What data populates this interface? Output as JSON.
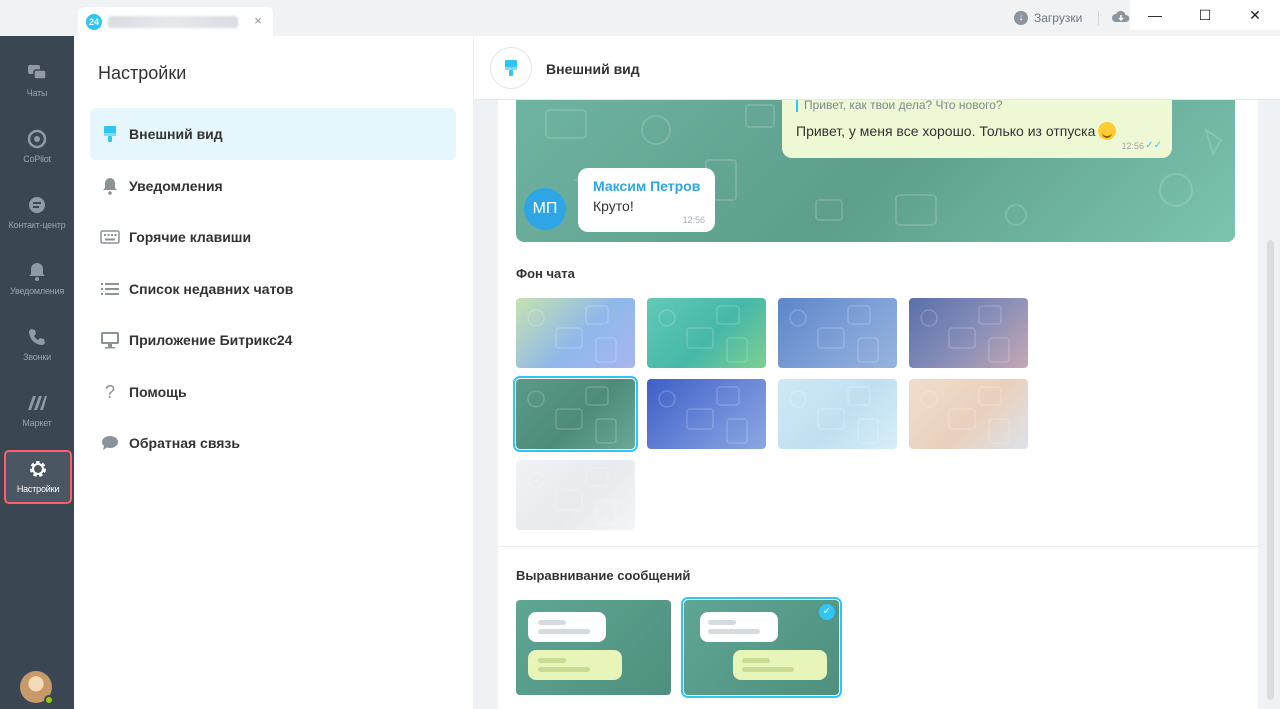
{
  "window": {
    "tab_badge": "24",
    "tab_close": "×",
    "downloads_label": "Загрузки",
    "minimize": "—",
    "maximize": "☐",
    "close": "✕"
  },
  "leftnav": {
    "items": [
      {
        "label": "Чаты",
        "icon": "chats-icon"
      },
      {
        "label": "CoPilot",
        "icon": "copilot-icon"
      },
      {
        "label": "Контакт-центр",
        "icon": "contact-center-icon"
      },
      {
        "label": "Уведомления",
        "icon": "bell-icon"
      },
      {
        "label": "Звонки",
        "icon": "phone-icon"
      },
      {
        "label": "Маркет",
        "icon": "market-icon"
      },
      {
        "label": "Настройки",
        "icon": "gear-icon"
      }
    ],
    "active_index": 6,
    "active_outline_color": "#ff5c6c"
  },
  "menu": {
    "title": "Настройки",
    "items": [
      {
        "label": "Внешний вид",
        "icon": "brush-icon"
      },
      {
        "label": "Уведомления",
        "icon": "bell-icon"
      },
      {
        "label": "Горячие клавиши",
        "icon": "keyboard-icon"
      },
      {
        "label": "Список недавних чатов",
        "icon": "list-icon"
      },
      {
        "label": "Приложение Битрикс24",
        "icon": "monitor-icon"
      },
      {
        "label": "Помощь",
        "icon": "help-icon"
      },
      {
        "label": "Обратная связь",
        "icon": "feedback-icon"
      }
    ],
    "active_index": 0
  },
  "content": {
    "header_title": "Внешний вид",
    "preview": {
      "quote": "Привет, как твои дела? Что нового?",
      "outgoing_text": "Привет, у меня все хорошо. Только из отпуска",
      "outgoing_time": "12:56",
      "sender_initials": "МП",
      "sender_name": "Максим Петров",
      "incoming_text": "Круто!",
      "incoming_time": "12:56"
    },
    "background_section_title": "Фон чата",
    "backgrounds": [
      {
        "name": "bg-1",
        "colors": [
          "#c6e3b0",
          "#8fb8ea",
          "#a9b6f0"
        ]
      },
      {
        "name": "bg-2",
        "colors": [
          "#62c9b6",
          "#46b8a8",
          "#7fcf8f"
        ]
      },
      {
        "name": "bg-3",
        "colors": [
          "#5b86c8",
          "#7fa0d8",
          "#98b4dc"
        ]
      },
      {
        "name": "bg-4",
        "colors": [
          "#5a6fab",
          "#8a8fb8",
          "#c7a8b3"
        ]
      },
      {
        "name": "bg-5",
        "colors": [
          "#5b9a86",
          "#4e8c7a",
          "#6aa994"
        ]
      },
      {
        "name": "bg-6",
        "colors": [
          "#3d5fc7",
          "#6b88d8",
          "#8aa8e0"
        ]
      },
      {
        "name": "bg-7",
        "colors": [
          "#cfe9f5",
          "#bfe0f2",
          "#d7eef8"
        ]
      },
      {
        "name": "bg-8",
        "colors": [
          "#f1ddcc",
          "#ead0bd",
          "#dde3ea"
        ]
      },
      {
        "name": "bg-9",
        "colors": [
          "#f0f2f4",
          "#e8ebee",
          "#f3f5f6"
        ]
      }
    ],
    "background_selected_index": 4,
    "alignment_section_title": "Выравнивание сообщений",
    "alignment_options": [
      {
        "name": "align-left"
      },
      {
        "name": "align-sides"
      }
    ],
    "alignment_selected_index": 1,
    "check_mark": "✓"
  },
  "colors": {
    "accent": "#2fc6f6",
    "nav_bg": "#3b4653",
    "active_menu_bg": "#e5f6fc"
  }
}
